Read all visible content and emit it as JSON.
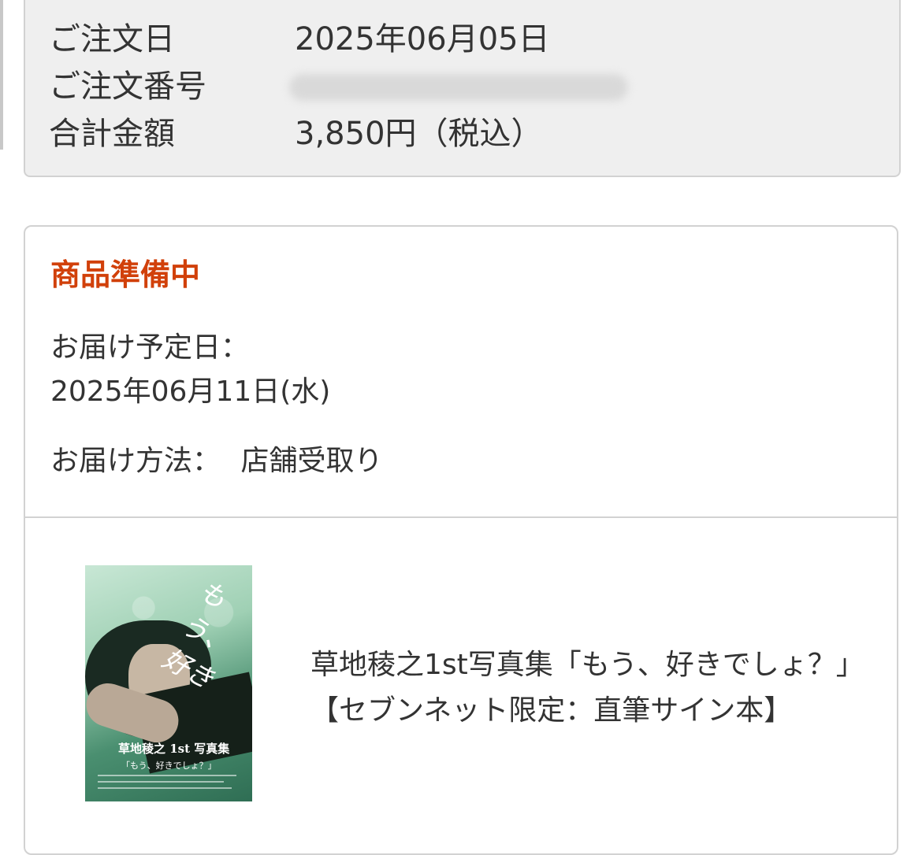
{
  "order_summary": {
    "order_date_label": "ご注文日",
    "order_date_value": "2025年06月05日",
    "order_number_label": "ご注文番号",
    "total_label": "合計金額",
    "total_value": "3,850円（税込）"
  },
  "status": {
    "title": "商品準備中",
    "delivery_date_label": "お届け予定日：",
    "delivery_date_value": "2025年06月11日(水)",
    "delivery_method_label": "お届け方法：",
    "delivery_method_value": "店舗受取り",
    "title_color": "#d1400a"
  },
  "product": {
    "name": "草地稜之1st写真集「もう、好きでしょ？」【セブンネット限定：直筆サイン本】",
    "cover_script": "もう、好き",
    "cover_title": "草地稜之 1st 写真集",
    "cover_subtitle": "「もう、好きでしょ？」"
  }
}
